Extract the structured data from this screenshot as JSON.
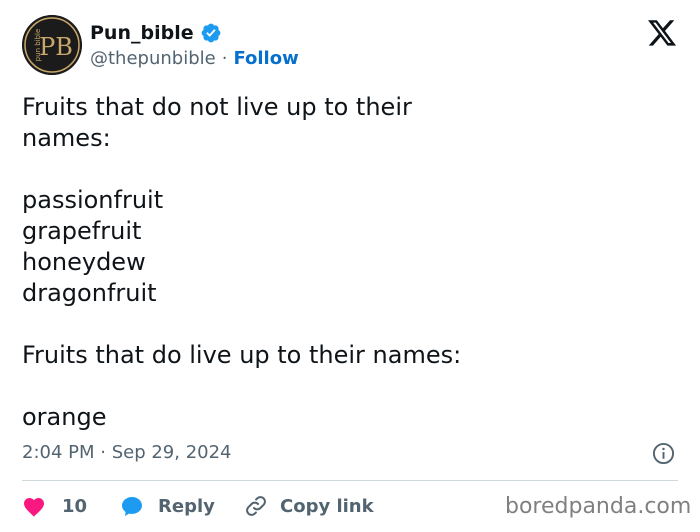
{
  "author": {
    "display_name": "Pun_bible",
    "handle": "@thepunbible",
    "separator": "·",
    "follow_label": "Follow",
    "avatar_text": "PB",
    "avatar_side_text": "pun bible"
  },
  "tweet": {
    "lines_group_1": [
      "Fruits that do not live up to their",
      "names:"
    ],
    "list_1": [
      "passionfruit",
      "grapefruit",
      "honeydew",
      "dragonfruit"
    ],
    "line_group_2": "Fruits that do live up to their names:",
    "list_2": [
      "orange"
    ]
  },
  "meta": {
    "timestamp": "2:04 PM · Sep 29, 2024"
  },
  "actions": {
    "like_count": "10",
    "reply_label": "Reply",
    "copy_link_label": "Copy link"
  },
  "watermark": "boredpanda.com",
  "icons": {
    "verified": "verified-badge-icon",
    "x_logo": "x-logo-icon",
    "info": "info-icon",
    "like": "heart-icon",
    "reply": "speech-bubble-icon",
    "copy_link": "link-icon"
  },
  "colors": {
    "text": "#0f1419",
    "secondary": "#536471",
    "accent": "#0670cf",
    "verified": "#1d9bf0",
    "like": "#f91880",
    "divider": "#cfd9de",
    "avatar_bg": "#1b1b1b",
    "avatar_gold": "#c9a86a"
  }
}
